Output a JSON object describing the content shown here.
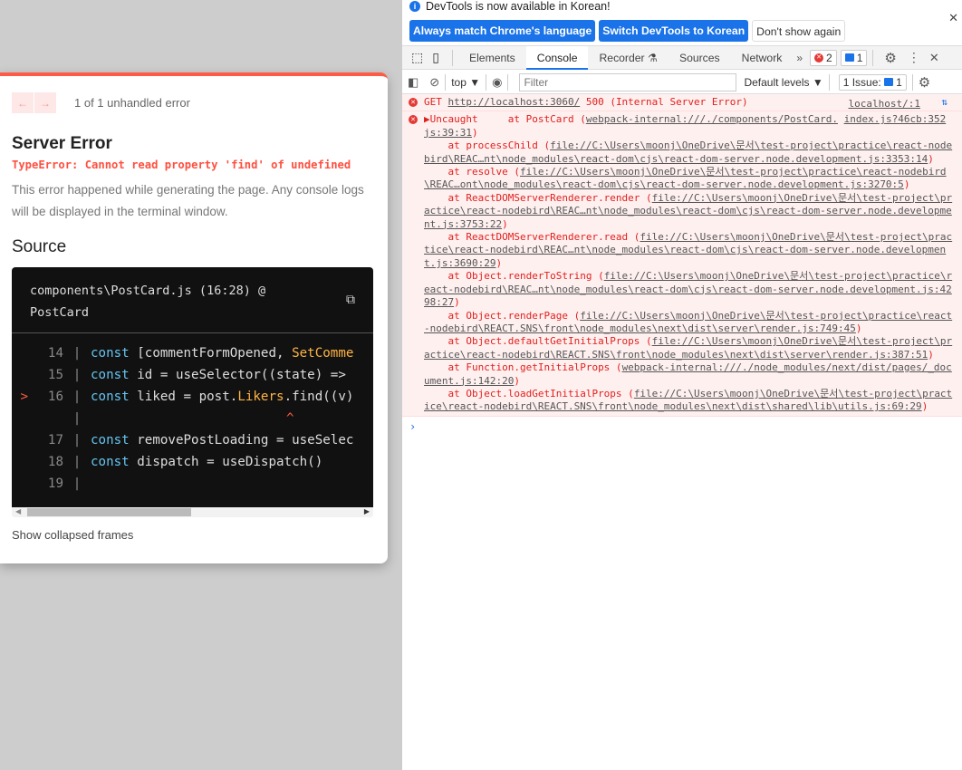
{
  "overlay": {
    "nav_prev": "←",
    "nav_next": "→",
    "count": "1 of 1 unhandled error",
    "title": "Server Error",
    "error": "TypeError: Cannot read property 'find' of undefined",
    "description": "This error happened while generating the page. Any console logs will be displayed in the terminal window.",
    "source_heading": "Source",
    "file": "components\\PostCard.js (16:28) @ PostCard",
    "lines": [
      {
        "no": "14",
        "marker": "",
        "kw": "const",
        "a": " [commentFormOpened, ",
        "hl": "SetComme",
        "b": ""
      },
      {
        "no": "15",
        "marker": "",
        "kw": "const",
        "a": " id = useSelector((state) =>",
        "hl": "",
        "b": ""
      },
      {
        "no": "16",
        "marker": ">",
        "kw": "const",
        "a": " liked = post.",
        "hl": "Likers",
        "b": ".find((v)"
      },
      {
        "no": "",
        "marker": "",
        "kw": "",
        "a": "",
        "hl": "",
        "b": "",
        "caret": "^"
      },
      {
        "no": "17",
        "marker": "",
        "kw": "const",
        "a": " removePostLoading = useSelec",
        "hl": "",
        "b": ""
      },
      {
        "no": "18",
        "marker": "",
        "kw": "const",
        "a": " dispatch = useDispatch()",
        "hl": "",
        "b": ""
      },
      {
        "no": "19",
        "marker": "",
        "kw": "",
        "a": "",
        "hl": "",
        "b": ""
      }
    ],
    "show_collapsed": "Show collapsed frames"
  },
  "devtools": {
    "info": "DevTools is now available in Korean!",
    "btn_match": "Always match Chrome's language",
    "btn_switch": "Switch DevTools to Korean",
    "btn_dont": "Don't show again",
    "tabs": [
      "Elements",
      "Console",
      "Recorder",
      "Sources",
      "Network"
    ],
    "more": "»",
    "errors": "2",
    "messages": "1",
    "context": "top ▼",
    "filter_placeholder": "Filter",
    "levels": "Default levels ▼",
    "issues": "1 Issue:",
    "issues_count": "1",
    "get_error": {
      "method": "GET ",
      "url": "http://localhost:3060/",
      "rest": " 500 (Internal Server Error)",
      "source": "localhost/:1"
    },
    "uncaught": {
      "label": "▶Uncaught",
      "first": "     at PostCard (",
      "first_link": "webpack-internal:///./components/PostCard.",
      "source": "index.js?46cb:352",
      "first_tail": "js:39:31",
      "close": ")"
    },
    "stack": [
      {
        "fn": "    at processChild (",
        "loc": "file://C:\\Users\\moonj\\OneDrive\\문서\\test-project\\practice\\react-nodebird\\REAC…nt\\node_modules\\react-dom\\cjs\\react-dom-server.node.development.js:3353:14"
      },
      {
        "fn": "    at resolve (",
        "loc": "file://C:\\Users\\moonj\\OneDrive\\문서\\test-project\\practice\\react-nodebird\\REAC…ont\\node_modules\\react-dom\\cjs\\react-dom-server.node.development.js:3270:5"
      },
      {
        "fn": "    at ReactDOMServerRenderer.render (",
        "loc": "file://C:\\Users\\moonj\\OneDrive\\문서\\test-project\\practice\\react-nodebird\\REAC…nt\\node_modules\\react-dom\\cjs\\react-dom-server.node.development.js:3753:22"
      },
      {
        "fn": "    at ReactDOMServerRenderer.read (",
        "loc": "file://C:\\Users\\moonj\\OneDrive\\문서\\test-project\\practice\\react-nodebird\\REAC…nt\\node_modules\\react-dom\\cjs\\react-dom-server.node.development.js:3690:29"
      },
      {
        "fn": "    at Object.renderToString (",
        "loc": "file://C:\\Users\\moonj\\OneDrive\\문서\\test-project\\practice\\react-nodebird\\REAC…nt\\node_modules\\react-dom\\cjs\\react-dom-server.node.development.js:4298:27"
      },
      {
        "fn": "    at Object.renderPage (",
        "loc": "file://C:\\Users\\moonj\\OneDrive\\문서\\test-project\\practice\\react-nodebird\\REACT.SNS\\front\\node_modules\\next\\dist\\server\\render.js:749:45"
      },
      {
        "fn": "    at Object.defaultGetInitialProps (",
        "loc": "file://C:\\Users\\moonj\\OneDrive\\문서\\test-project\\practice\\react-nodebird\\REACT.SNS\\front\\node_modules\\next\\dist\\server\\render.js:387:51"
      },
      {
        "fn": "    at Function.getInitialProps (",
        "loc": "webpack-internal:///./node_modules/next/dist/pages/_document.js:142:20"
      },
      {
        "fn": "    at Object.loadGetInitialProps (",
        "loc": "file://C:\\Users\\moonj\\OneDrive\\문서\\test-project\\practice\\react-nodebird\\REACT.SNS\\front\\node_modules\\next\\dist\\shared\\lib\\utils.js:69:29"
      }
    ],
    "prompt": "›"
  }
}
